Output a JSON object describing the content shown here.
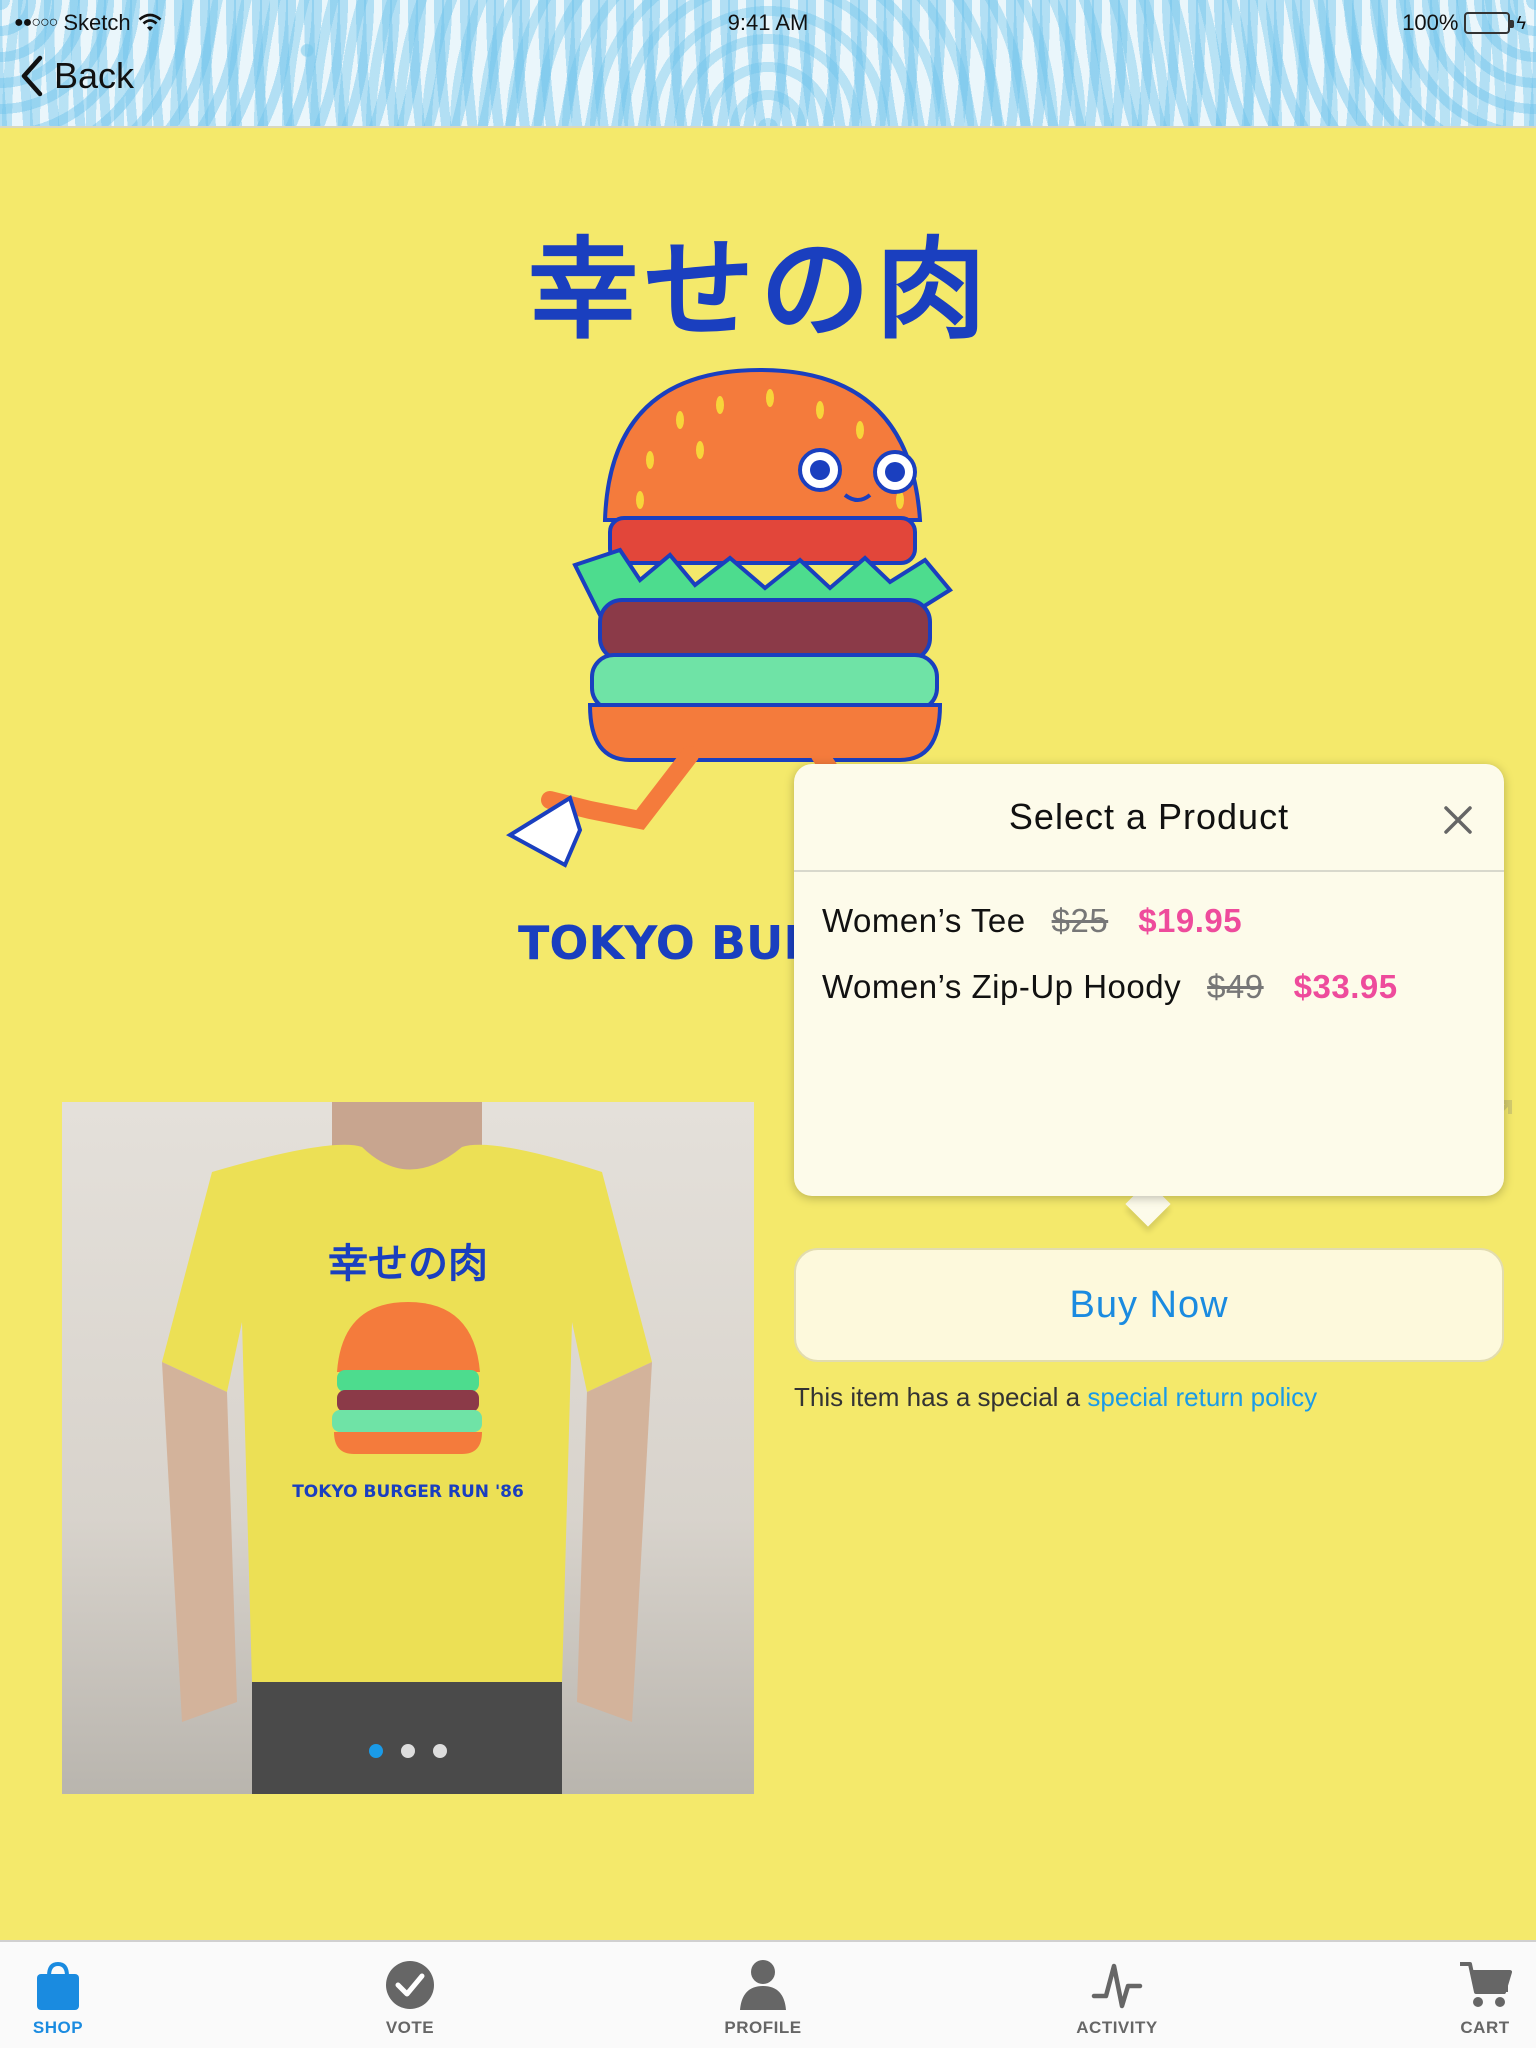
{
  "status_bar": {
    "carrier": "Sketch",
    "time": "9:41 AM",
    "battery": "100%",
    "battery_level": 1.0
  },
  "nav": {
    "back_label": "Back"
  },
  "artwork": {
    "title": "幸せの肉",
    "caption": "TOKYO BURGER RUN '86"
  },
  "gallery": {
    "pages": 3,
    "active_page": 1
  },
  "popover": {
    "title": "Select a Product",
    "products": [
      {
        "name": "Women’s Tee",
        "old_price": "$25",
        "price": "$19.95"
      },
      {
        "name": "Women’s Zip-Up Hoody",
        "old_price": "$49",
        "price": "$33.95"
      }
    ]
  },
  "buy": {
    "label": "Buy Now"
  },
  "return_policy": {
    "text": "This item has a special a ",
    "link": "special return policy"
  },
  "tabs": [
    {
      "label": "SHOP",
      "icon": "shopping-bag-icon",
      "active": true
    },
    {
      "label": "VOTE",
      "icon": "checkmark-icon",
      "active": false
    },
    {
      "label": "PROFILE",
      "icon": "person-icon",
      "active": false
    },
    {
      "label": "ACTIVITY",
      "icon": "activity-icon",
      "active": false
    },
    {
      "label": "CART",
      "icon": "cart-icon",
      "active": false
    }
  ],
  "colors": {
    "background": "#f4e96b",
    "accent": "#1a8be0",
    "sale": "#ee4b9c",
    "art_blue": "#1a3fbf"
  }
}
